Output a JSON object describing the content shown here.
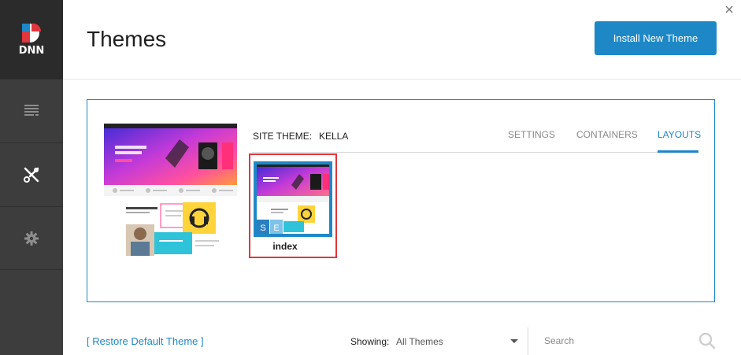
{
  "app": {
    "logo_text": "DNN",
    "colors": {
      "accent": "#1e88c7",
      "sidebar": "#3d3d3d",
      "sidebar_top": "#2b2b2b",
      "highlight": "#e0373e"
    }
  },
  "sidebar": {
    "items": [
      {
        "icon": "content-icon"
      },
      {
        "icon": "tools-icon",
        "active": true
      },
      {
        "icon": "gear-icon"
      }
    ]
  },
  "header": {
    "title": "Themes",
    "install_button": "Install New Theme"
  },
  "site_theme": {
    "label": "SITE THEME:",
    "value": "KELLA"
  },
  "tabs": [
    {
      "label": "SETTINGS",
      "active": false
    },
    {
      "label": "CONTAINERS",
      "active": false
    },
    {
      "label": "LAYOUTS",
      "active": true
    }
  ],
  "layouts": [
    {
      "name": "index"
    }
  ],
  "footer": {
    "restore_link": "[ Restore Default Theme ]",
    "showing_label": "Showing:",
    "showing_value": "All Themes",
    "search_placeholder": "Search"
  }
}
